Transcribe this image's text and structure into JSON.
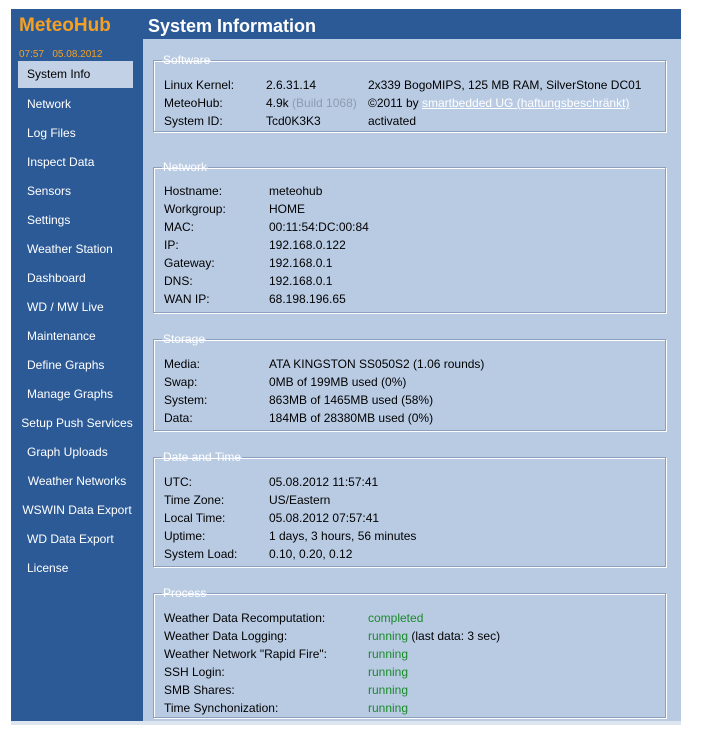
{
  "app": {
    "brand": "MeteoHub",
    "clock_time": "07:57",
    "clock_date": "05.08.2012"
  },
  "sidebar": {
    "items": [
      {
        "label": "System Info"
      },
      {
        "label": "Network"
      },
      {
        "label": "Log Files"
      },
      {
        "label": "Inspect Data"
      },
      {
        "label": "Sensors"
      },
      {
        "label": "Settings"
      },
      {
        "label": "Weather Station"
      },
      {
        "label": "Dashboard"
      },
      {
        "label": "WD / MW Live"
      },
      {
        "label": "Maintenance"
      },
      {
        "label": "Define Graphs"
      },
      {
        "label": "Manage Graphs"
      },
      {
        "label": "Setup Push Services"
      },
      {
        "label": "Graph Uploads"
      },
      {
        "label": "Weather Networks"
      },
      {
        "label": "WSWIN Data Export"
      },
      {
        "label": "WD Data Export"
      },
      {
        "label": "License"
      }
    ]
  },
  "header": {
    "title": "System Information"
  },
  "software": {
    "legend": "Software",
    "kernel_label": "Linux Kernel:",
    "kernel_value": "2.6.31.14",
    "kernel_extra": "2x339 BogoMIPS, 125 MB RAM, SilverStone DC01",
    "meteohub_label": "MeteoHub:",
    "meteohub_version": "4.9k",
    "meteohub_build": "(Build 1068)",
    "copyright_prefix": "©2011 by",
    "copyright_link": "smartbedded UG (haftungsbeschränkt)",
    "sysid_label": "System ID:",
    "sysid_value": "Tcd0K3K3",
    "sysid_status": "activated"
  },
  "network": {
    "legend": "Network",
    "rows": [
      {
        "label": "Hostname:",
        "value": "meteohub"
      },
      {
        "label": "Workgroup:",
        "value": "HOME"
      },
      {
        "label": "MAC:",
        "value": "00:11:54:DC:00:84"
      },
      {
        "label": "IP:",
        "value": "192.168.0.122"
      },
      {
        "label": "Gateway:",
        "value": "192.168.0.1"
      },
      {
        "label": "DNS:",
        "value": "192.168.0.1"
      },
      {
        "label": "WAN IP:",
        "value": "68.198.196.65"
      }
    ]
  },
  "storage": {
    "legend": "Storage",
    "rows": [
      {
        "label": "Media:",
        "value": "ATA KINGSTON SS050S2 (1.06 rounds)"
      },
      {
        "label": "Swap:",
        "value": "0MB of 199MB used (0%)"
      },
      {
        "label": "System:",
        "value": "863MB of 1465MB used (58%)"
      },
      {
        "label": "Data:",
        "value": "184MB of 28380MB used (0%)"
      }
    ]
  },
  "datetime": {
    "legend": "Date and Time",
    "rows": [
      {
        "label": "UTC:",
        "value": "05.08.2012 11:57:41"
      },
      {
        "label": "Time Zone:",
        "value": "US/Eastern"
      },
      {
        "label": "Local Time:",
        "value": "05.08.2012 07:57:41"
      },
      {
        "label": "Uptime:",
        "value": "1 days, 3 hours, 56 minutes"
      },
      {
        "label": "System Load:",
        "value": "0.10, 0.20, 0.12"
      }
    ]
  },
  "process": {
    "legend": "Process",
    "rows": [
      {
        "label": "Weather Data Recomputation:",
        "status": "completed",
        "note": ""
      },
      {
        "label": "Weather Data Logging:",
        "status": "running",
        "note": "(last data: 3 sec)"
      },
      {
        "label": "Weather Network \"Rapid Fire\":",
        "status": "running",
        "note": ""
      },
      {
        "label": "SSH Login:",
        "status": "running",
        "note": ""
      },
      {
        "label": "SMB Shares:",
        "status": "running",
        "note": ""
      },
      {
        "label": "Time Synchonization:",
        "status": "running",
        "note": ""
      }
    ]
  },
  "colors": {
    "frame_blue": "#2c5a96",
    "content_blue": "#b9cbe3",
    "brand_orange": "#f5a020",
    "status_green": "#1a8a2a"
  }
}
